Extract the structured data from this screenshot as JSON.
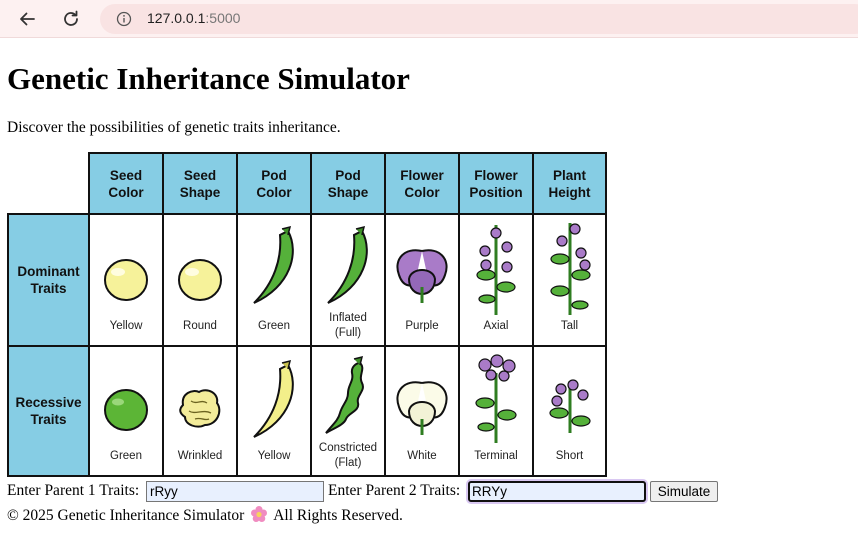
{
  "browser": {
    "url_host": "127.0.0.1",
    "url_port": ":5000"
  },
  "page": {
    "title": "Genetic Inheritance Simulator",
    "intro": "Discover the possibilities of genetic traits inheritance."
  },
  "chart": {
    "columns": [
      "Seed\nColor",
      "Seed\nShape",
      "Pod\nColor",
      "Pod\nShape",
      "Flower\nColor",
      "Flower\nPosition",
      "Plant\nHeight"
    ],
    "rows": [
      {
        "header": "Dominant\nTraits",
        "labels": [
          "Yellow",
          "Round",
          "Green",
          "Inflated\n(Full)",
          "Purple",
          "Axial",
          "Tall"
        ]
      },
      {
        "header": "Recessive\nTraits",
        "labels": [
          "Green",
          "Wrinkled",
          "Yellow",
          "Constricted\n(Flat)",
          "White",
          "Terminal",
          "Short"
        ]
      }
    ],
    "colors": {
      "header_bg": "#86cde4",
      "yellow_pea": "#f6f29a",
      "green_pea": "#5cb536",
      "green_pod": "#55b13a",
      "yellow_pod": "#f3ef8a",
      "purple_flower": "#a97bc8",
      "white_flower": "#fbfbe8"
    }
  },
  "form": {
    "parent1_label": "Enter Parent 1 Traits:",
    "parent1_value": "rRyy",
    "parent2_label": "Enter Parent 2 Traits:",
    "parent2_value": "RRYy",
    "simulate_label": "Simulate"
  },
  "footer": {
    "left": "© 2025 Genetic Inheritance Simulator",
    "right": "All Rights Reserved.",
    "icon": "flower-icon"
  }
}
